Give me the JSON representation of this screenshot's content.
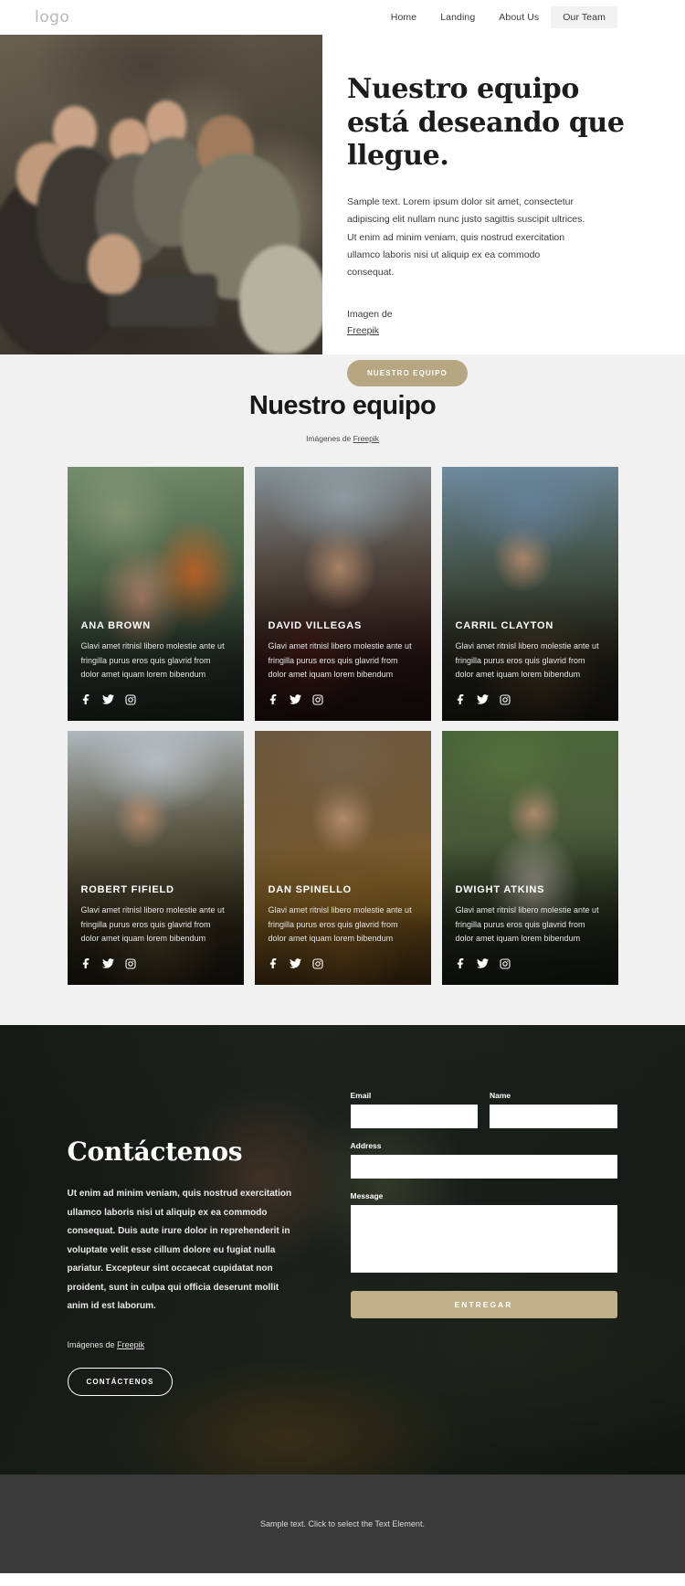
{
  "header": {
    "logo": "logo",
    "nav": [
      {
        "label": "Home",
        "active": false
      },
      {
        "label": "Landing",
        "active": false
      },
      {
        "label": "About Us",
        "active": false
      },
      {
        "label": "Our Team",
        "active": true
      }
    ]
  },
  "hero": {
    "title": "Nuestro equipo está deseando que llegue.",
    "paragraph": "Sample text. Lorem ipsum dolor sit amet, consectetur adipiscing elit nullam nunc justo sagittis suscipit ultrices. Ut enim ad minim veniam, quis nostrud exercitation ullamco laboris nisi ut aliquip ex ea commodo consequat.",
    "credit_prefix": "Imagen de",
    "credit_link": "Freepik",
    "cta_label": "NUESTRO EQUIPO",
    "cta_color": "#b6a782"
  },
  "team": {
    "title": "Nuestro equipo",
    "subtitle_prefix": "Imágenes de",
    "subtitle_link": "Freepik",
    "members": [
      {
        "name": "ANA BROWN",
        "description": "Glavi amet ritnisl libero molestie ante ut fringilla purus eros quis glavrid from dolor amet iquam lorem bibendum",
        "socials": [
          "facebook-icon",
          "twitter-icon",
          "instagram-icon"
        ]
      },
      {
        "name": "DAVID VILLEGAS",
        "description": "Glavi amet ritnisl libero molestie ante ut fringilla purus eros quis glavrid from dolor amet iquam lorem bibendum",
        "socials": [
          "facebook-icon",
          "twitter-icon",
          "instagram-icon"
        ]
      },
      {
        "name": "CARRIL CLAYTON",
        "description": "Glavi amet ritnisl libero molestie ante ut fringilla purus eros quis glavrid from dolor amet iquam lorem bibendum",
        "socials": [
          "facebook-icon",
          "twitter-icon",
          "instagram-icon"
        ]
      },
      {
        "name": "ROBERT FIFIELD",
        "description": "Glavi amet ritnisl libero molestie ante ut fringilla purus eros quis glavrid from dolor amet iquam lorem bibendum",
        "socials": [
          "facebook-icon",
          "twitter-icon",
          "instagram-icon"
        ]
      },
      {
        "name": "DAN SPINELLO",
        "description": "Glavi amet ritnisl libero molestie ante ut fringilla purus eros quis glavrid from dolor amet iquam lorem bibendum",
        "socials": [
          "facebook-icon",
          "twitter-icon",
          "instagram-icon"
        ]
      },
      {
        "name": "DWIGHT ATKINS",
        "description": "Glavi amet ritnisl libero molestie ante ut fringilla purus eros quis glavrid from dolor amet iquam lorem bibendum",
        "socials": [
          "facebook-icon",
          "twitter-icon",
          "instagram-icon"
        ]
      }
    ]
  },
  "contact": {
    "title": "Contáctenos",
    "paragraph": "Ut enim ad minim veniam, quis nostrud exercitation ullamco laboris nisi ut aliquip ex ea commodo consequat. Duis aute irure dolor in reprehenderit in voluptate velit esse cillum dolore eu fugiat nulla pariatur. Excepteur sint occaecat cupidatat non proident, sunt in culpa qui officia deserunt mollit anim id est laborum.",
    "credit_prefix": "Imágenes de",
    "credit_link": "Freepik",
    "cta_label": "CONTÁCTENOS",
    "form": {
      "email_label": "Email",
      "email_value": "",
      "email_placeholder": "",
      "name_label": "Name",
      "name_value": "",
      "name_placeholder": "",
      "address_label": "Address",
      "address_value": "",
      "address_placeholder": "",
      "message_label": "Message",
      "message_value": "",
      "message_placeholder": "",
      "submit_label": "ENTREGAR",
      "submit_color": "#bfb089"
    }
  },
  "footer": {
    "text": "Sample text. Click to select the Text Element."
  }
}
